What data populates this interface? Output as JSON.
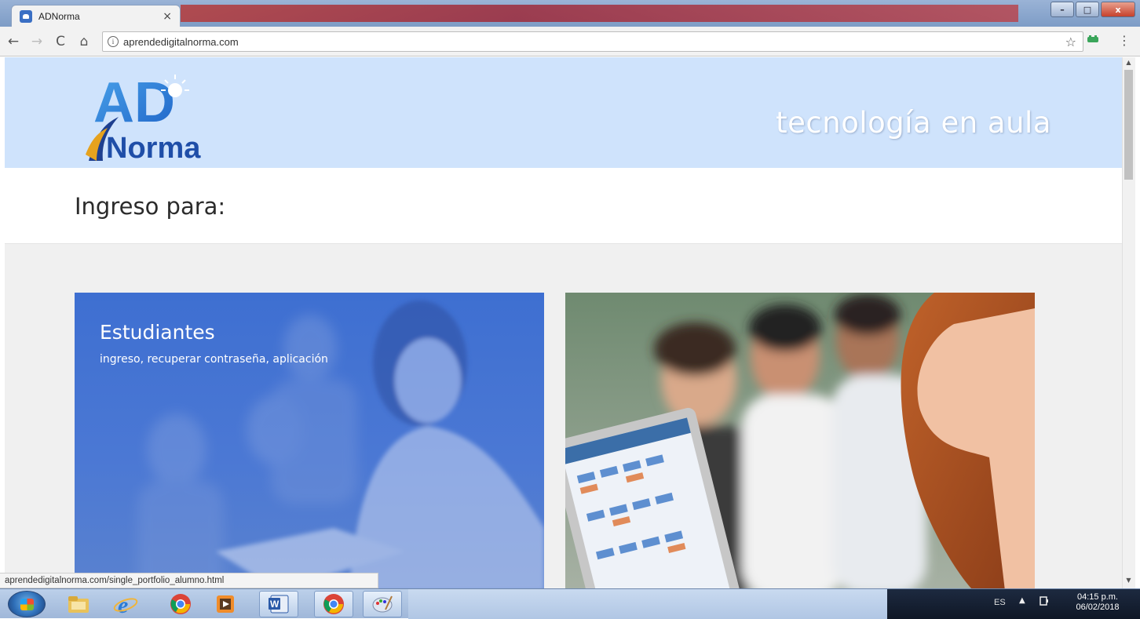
{
  "window": {
    "tab_title": "ADNorma",
    "tab_close": "×",
    "minimize": "–",
    "maximize": "□",
    "close": "x"
  },
  "toolbar": {
    "back": "←",
    "forward": "→",
    "reload": "C",
    "home": "⌂",
    "url": "aprendedigitalnorma.com",
    "info": "i",
    "star": "☆",
    "menu": "⋮"
  },
  "page": {
    "logo_alt": "AD Norma",
    "logo_text_top": "AD",
    "logo_text_bottom": "Norma",
    "tagline": "tecnología en aula",
    "ingreso_title": "Ingreso para:",
    "cards": [
      {
        "title": "Estudiantes",
        "subtitle": "ingreso, recuperar contraseña, aplicación"
      }
    ]
  },
  "status_bar": {
    "url": "aprendedigitalnorma.com/single_portfolio_alumno.html"
  },
  "taskbar": {
    "language": "ES",
    "time": "04:15 p.m.",
    "date": "06/02/2018"
  },
  "colors": {
    "header_band": "#cfe3fc",
    "card_blue": "#4a77d3",
    "logo_blue": "#1f64c8"
  },
  "icons": [
    "back-icon",
    "forward-icon",
    "reload-icon",
    "home-icon",
    "info-icon",
    "star-icon",
    "extension-icon",
    "menu-icon",
    "windows-start-icon",
    "explorer-icon",
    "ie-icon",
    "chrome-icon",
    "media-icon",
    "word-icon",
    "paint-icon",
    "network-icon",
    "tray-arrow-icon"
  ]
}
